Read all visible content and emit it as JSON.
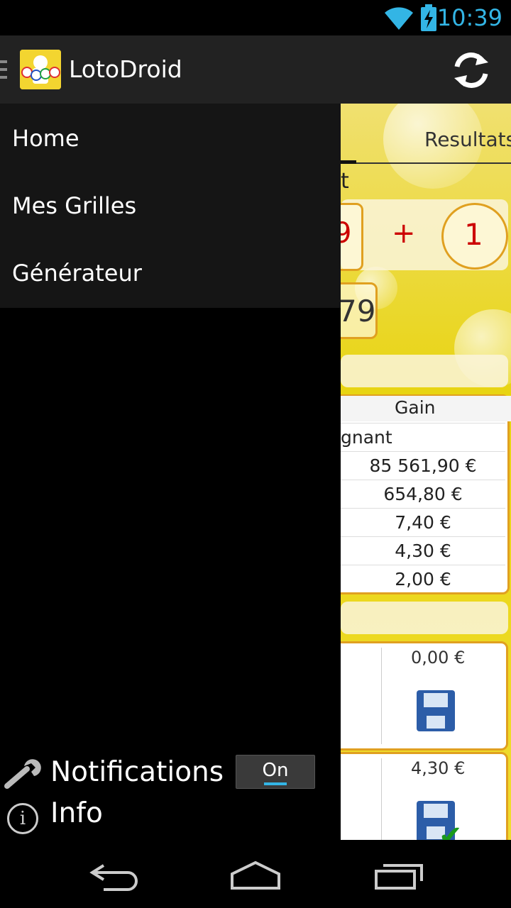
{
  "status_bar": {
    "time": "10:39",
    "icons": [
      "wifi-icon",
      "battery-charging-icon"
    ],
    "accent": "#33b5e5"
  },
  "action_bar": {
    "title": "LotoDroid",
    "app_icon": "app-icon",
    "refresh_icon": "refresh-icon",
    "background": "#222222"
  },
  "drawer": {
    "items": [
      {
        "label": "Home"
      },
      {
        "label": "Mes Grilles"
      },
      {
        "label": "Générateur"
      }
    ],
    "notifications": {
      "label": "Notifications",
      "toggle": "On",
      "icon": "wrench-icon"
    },
    "info": {
      "label": "Info",
      "icon": "info-icon"
    }
  },
  "background_content": {
    "tab": "Resultats",
    "partial_text": "t",
    "ball_left": "9",
    "plus": "+",
    "chance": "1",
    "draw_number": "79",
    "gain_header": "Gain",
    "gain_rows": [
      "gnant",
      "85 561,90 €",
      "654,80 €",
      "7,40 €",
      "4,30 €",
      "2,00 €"
    ],
    "grids": [
      {
        "amount": "0,00 €"
      },
      {
        "amount": "4,30 €"
      }
    ],
    "accent": "#e0a020",
    "win_color": "#cc0000"
  },
  "nav_bar": {
    "icons": [
      "back-icon",
      "home-icon",
      "recent-apps-icon"
    ]
  }
}
